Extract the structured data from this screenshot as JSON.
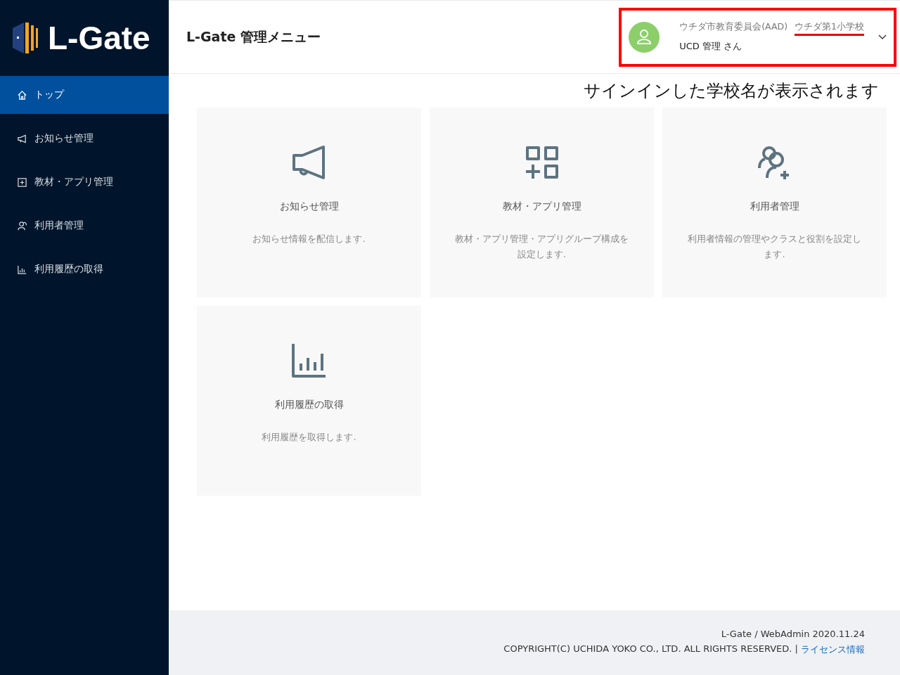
{
  "logo": {
    "text": "L-Gate"
  },
  "sidebar": {
    "items": [
      {
        "kind": "home",
        "label": "トップ",
        "selected": true
      },
      {
        "kind": "notice",
        "label": "お知らせ管理",
        "selected": false
      },
      {
        "kind": "apps",
        "label": "教材・アプリ管理",
        "selected": false
      },
      {
        "kind": "users",
        "label": "利用者管理",
        "selected": false
      },
      {
        "kind": "history",
        "label": "利用履歴の取得",
        "selected": false
      }
    ]
  },
  "header": {
    "title": "L-Gate 管理メニュー",
    "user": {
      "organization": "ウチダ市教育委員会(AAD)",
      "school": "ウチダ第1小学校",
      "name": "UCD 管理 さん"
    }
  },
  "annotation": {
    "caption": "サインインした学校名が表示されます"
  },
  "cards": [
    {
      "kind": "notice",
      "title": "お知らせ管理",
      "description": "お知らせ情報を配信します."
    },
    {
      "kind": "apps",
      "title": "教材・アプリ管理",
      "description": "教材・アプリ管理・アプリグループ構成を設定します."
    },
    {
      "kind": "users",
      "title": "利用者管理",
      "description": "利用者情報の管理やクラスと役割を設定します."
    },
    {
      "kind": "history",
      "title": "利用履歴の取得",
      "description": "利用履歴を取得します."
    }
  ],
  "footer": {
    "version": "L-Gate / WebAdmin 2020.11.24",
    "copyright": "COPYRIGHT(C) UCHIDA YOKO CO., LTD. ALL RIGHTS RESERVED. |",
    "license_link": "ライセンス情報"
  }
}
